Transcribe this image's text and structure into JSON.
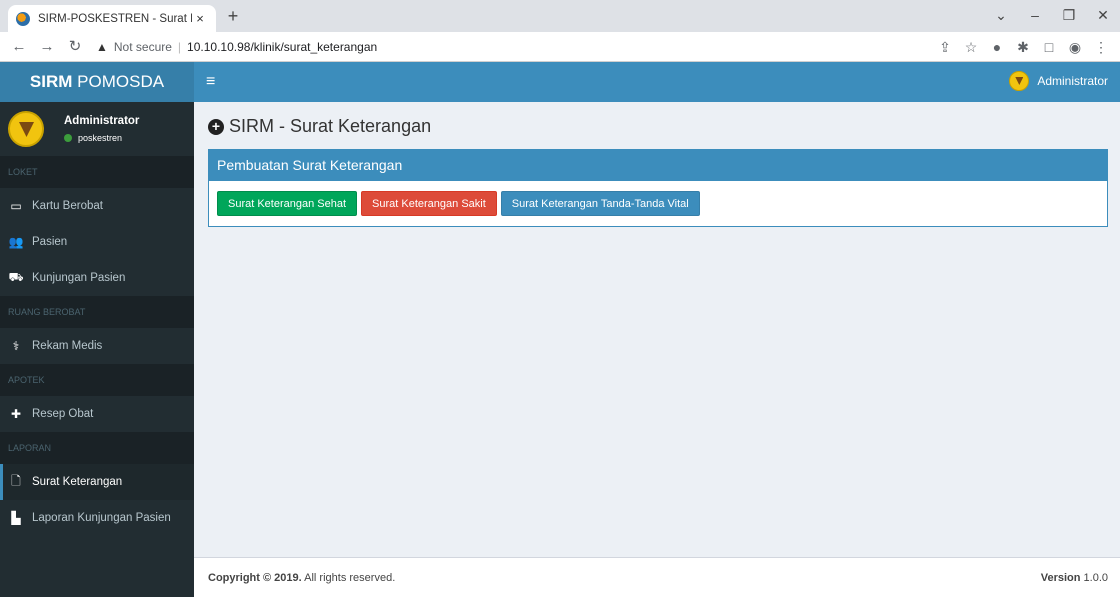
{
  "browser": {
    "tab_title": "SIRM-POSKESTREN - Surat Keteran",
    "tab_close": "×",
    "new_tab": "+",
    "not_secure": "Not secure",
    "url": "10.10.10.98/klinik/surat_keterangan"
  },
  "header": {
    "logo_bold": "SIRM",
    "logo_rest": "POMOSDA",
    "user_label": "Administrator"
  },
  "sidebar": {
    "user_name": "Administrator",
    "user_status": "poskestren",
    "sections": [
      {
        "header": "LOKET",
        "items": [
          "Kartu Berobat",
          "Pasien",
          "Kunjungan Pasien"
        ]
      },
      {
        "header": "RUANG BEROBAT",
        "items": [
          "Rekam Medis"
        ]
      },
      {
        "header": "APOTEK",
        "items": [
          "Resep Obat"
        ]
      },
      {
        "header": "LAPORAN",
        "items": [
          "Surat Keterangan",
          "Laporan Kunjungan Pasien"
        ]
      }
    ],
    "active_item": "Surat Keterangan"
  },
  "main": {
    "page_title": "SIRM - Surat Keterangan",
    "box_title": "Pembuatan Surat Keterangan",
    "buttons": {
      "sehat": "Surat Keterangan Sehat",
      "sakit": "Surat Keterangan Sakit",
      "vital": "Surat Keterangan Tanda-Tanda Vital"
    }
  },
  "footer": {
    "copyright_prefix": "Copyright ©",
    "copyright_year": "2019.",
    "copyright_suffix": "All rights reserved.",
    "version_label": "Version",
    "version_value": "1.0.0"
  },
  "colors": {
    "primary": "#3c8dbc",
    "success": "#00a65a",
    "danger": "#dd4b39",
    "sidebar_bg": "#222d32"
  }
}
